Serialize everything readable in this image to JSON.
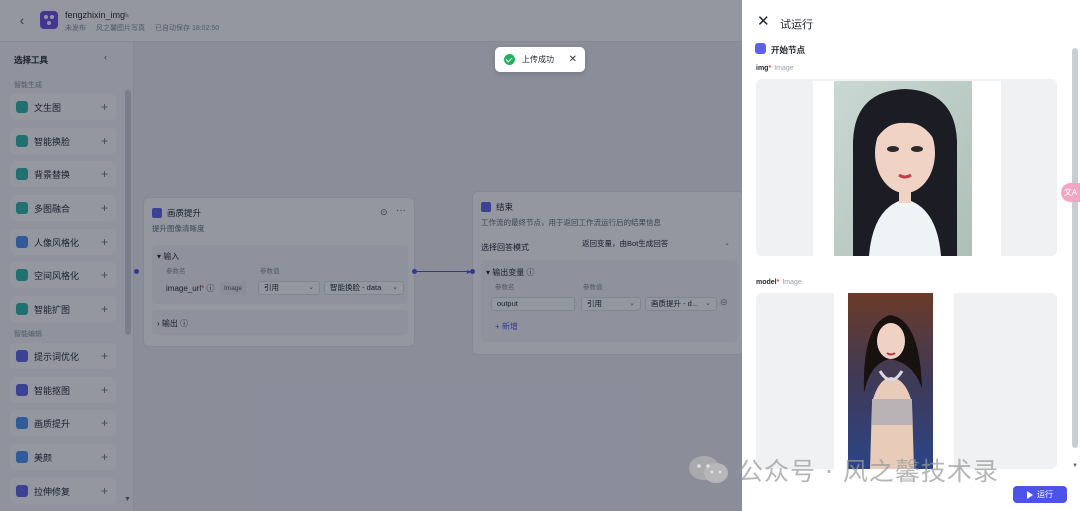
{
  "header": {
    "app_name": "fengzhixin_img",
    "status": "未发布",
    "category": "风之馨图片写真",
    "autosave": "已自动保存 18:02:50"
  },
  "sidebar": {
    "title": "选择工具",
    "group_generate": "智能生成",
    "group_edit": "智能编辑",
    "tools": [
      {
        "label": "文生图",
        "color": "#2bb9a8"
      },
      {
        "label": "智能换脸",
        "color": "#2bb9a8"
      },
      {
        "label": "背景替换",
        "color": "#2bb9a8"
      },
      {
        "label": "多图融合",
        "color": "#2bb9a8"
      },
      {
        "label": "人像风格化",
        "color": "#4b8ef0"
      },
      {
        "label": "空间风格化",
        "color": "#2bb9a8"
      },
      {
        "label": "智能扩图",
        "color": "#2bb9a8"
      },
      {
        "label": "提示词优化",
        "color": "#5b62e8"
      },
      {
        "label": "智能抠图",
        "color": "#5b62e8"
      },
      {
        "label": "画质提升",
        "color": "#4b8ef0"
      },
      {
        "label": "美颜",
        "color": "#4b8ef0"
      },
      {
        "label": "拉伸修复",
        "color": "#5b62e8"
      }
    ]
  },
  "node_enhance": {
    "title": "画质提升",
    "desc": "提升图像清晰度",
    "input_label": "输入",
    "col_name": "参数名",
    "col_value": "参数值",
    "param_name": "image_url",
    "param_type": "Image",
    "ref_mode": "引用",
    "ref_value": "智能换脸 - data",
    "output_label": "输出"
  },
  "node_end": {
    "title": "结束",
    "desc": "工作流的最终节点，用于返回工作流运行后的结果信息",
    "mode_label": "选择回答模式",
    "mode_value": "返回变量，由Bot生成回答",
    "output_var_label": "输出变量",
    "col_name": "参数名",
    "col_value": "参数值",
    "param_name": "output",
    "ref_mode": "引用",
    "ref_value": "画质提升 - d...",
    "add_label": "新增"
  },
  "toast": {
    "text": "上传成功"
  },
  "run_panel": {
    "title": "试运行",
    "start_node": "开始节点",
    "params": [
      {
        "name": "img",
        "type": "Image"
      },
      {
        "name": "model",
        "type": "Image"
      }
    ],
    "run_label": "运行"
  },
  "float_button": {
    "label": "文A"
  },
  "watermark": {
    "text": "公众号 · 风之馨技术录"
  },
  "colors": {
    "accent": "#4d53e8",
    "success": "#21b25e",
    "overlay": "#161a30"
  }
}
